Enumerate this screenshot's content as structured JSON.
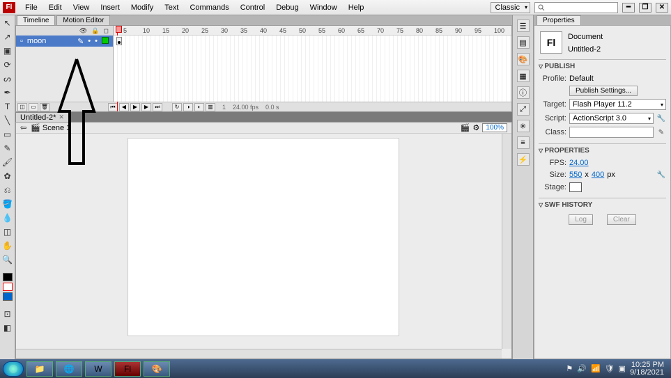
{
  "menubar": {
    "items": [
      "File",
      "Edit",
      "View",
      "Insert",
      "Modify",
      "Text",
      "Commands",
      "Control",
      "Debug",
      "Window",
      "Help"
    ],
    "workspace": "Classic"
  },
  "panel_tabs": {
    "timeline": "Timeline",
    "motion_editor": "Motion Editor"
  },
  "timeline": {
    "layer": {
      "name": "moon"
    },
    "ruler_majors": [
      5,
      10,
      15,
      20,
      25,
      30,
      35,
      40,
      45,
      50,
      55,
      60,
      65,
      70,
      75,
      80,
      85,
      90,
      95,
      100
    ],
    "status": {
      "frame": "1",
      "fps": "24.00 fps",
      "time": "0.0 s"
    }
  },
  "doc_tab": {
    "name": "Untitled-2*",
    "scene": "Scene 1",
    "zoom": "100%"
  },
  "properties": {
    "panel_title": "Properties",
    "type": "Document",
    "name": "Untitled-2",
    "publish": {
      "title": "Publish",
      "profile_label": "Profile:",
      "profile_value": "Default",
      "settings_btn": "Publish Settings...",
      "target_label": "Target:",
      "target_value": "Flash Player 11.2",
      "script_label": "Script:",
      "script_value": "ActionScript 3.0",
      "class_label": "Class:"
    },
    "props": {
      "title": "Properties",
      "fps_label": "FPS:",
      "fps_value": "24.00",
      "size_label": "Size:",
      "w": "550",
      "x": "x",
      "h": "400",
      "px": "px",
      "stage_label": "Stage:"
    },
    "swf": {
      "title": "SWF History",
      "log_btn": "Log",
      "clear_btn": "Clear"
    }
  },
  "taskbar": {
    "time": "10:25 PM",
    "date": "9/18/2021"
  }
}
